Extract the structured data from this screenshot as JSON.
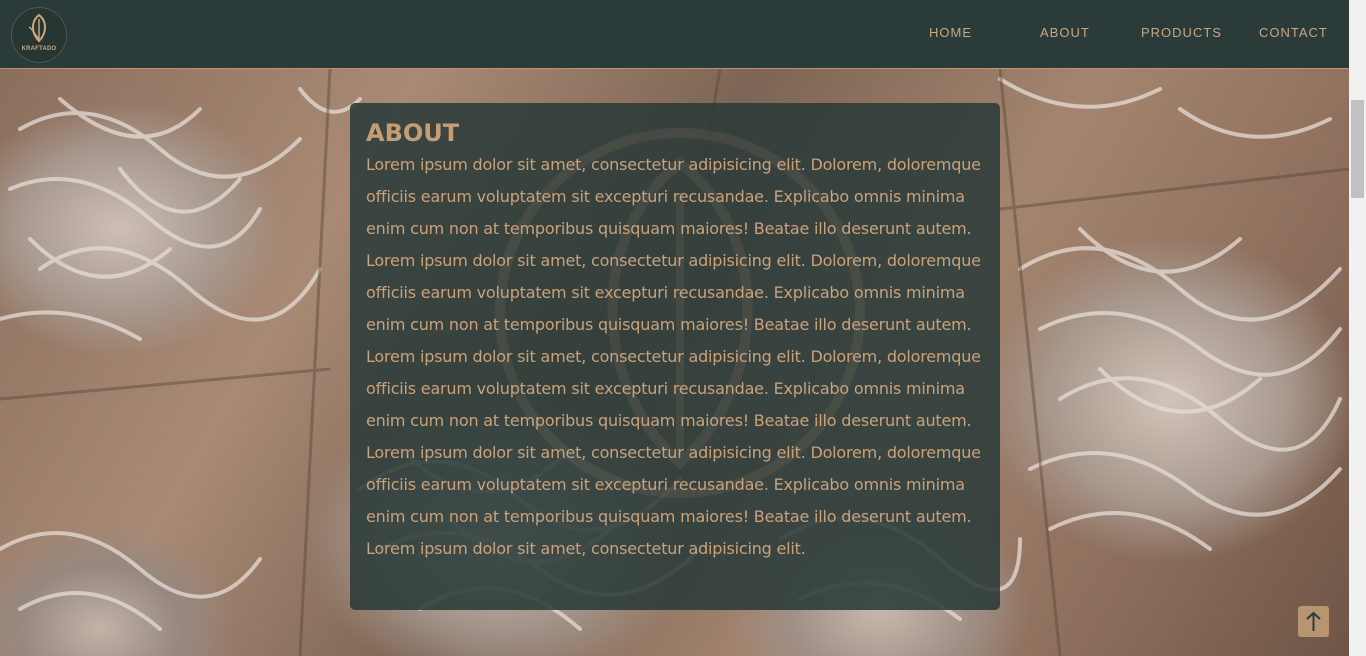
{
  "header": {
    "logo_text": "KRAFTADO",
    "nav": [
      {
        "label": "HOME"
      },
      {
        "label": "ABOUT"
      },
      {
        "label": "PRODUCTS"
      },
      {
        "label": "CONTACT"
      }
    ]
  },
  "about": {
    "title": "ABOUT",
    "body": "Lorem ipsum dolor sit amet, consectetur adipisicing elit. Dolorem, doloremque officiis earum voluptatem sit excepturi recusandae. Explicabo omnis minima enim cum non at temporibus quisquam maiores! Beatae illo deserunt autem. Lorem ipsum dolor sit amet, consectetur adipisicing elit. Dolorem, doloremque officiis earum voluptatem sit excepturi recusandae. Explicabo omnis minima enim cum non at temporibus quisquam maiores! Beatae illo deserunt autem. Lorem ipsum dolor sit amet, consectetur adipisicing elit. Dolorem, doloremque officiis earum voluptatem sit excepturi recusandae. Explicabo omnis minima enim cum non at temporibus quisquam maiores! Beatae illo deserunt autem. Lorem ipsum dolor sit amet, consectetur adipisicing elit. Dolorem, doloremque officiis earum voluptatem sit excepturi recusandae. Explicabo omnis minima enim cum non at temporibus quisquam maiores! Beatae illo deserunt autem. Lorem ipsum dolor sit amet, consectetur adipisicing elit."
  },
  "icons": {
    "logo": "leaf-logo-icon",
    "scroll_top": "arrow-up-icon"
  },
  "colors": {
    "header_bg": "#2b3b3a",
    "accent": "#c49d72",
    "card_bg": "#2b3b3a"
  }
}
